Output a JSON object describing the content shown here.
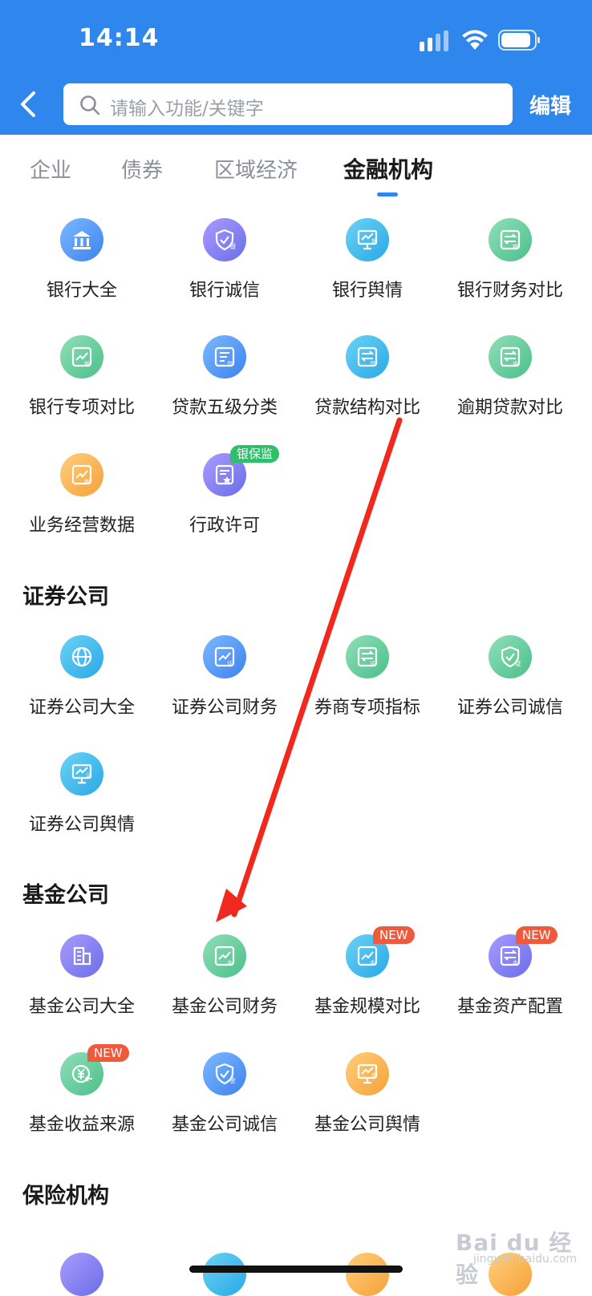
{
  "status_bar": {
    "time": "14:14"
  },
  "header": {
    "search_placeholder": "请输入功能/关键字",
    "edit_label": "编辑"
  },
  "tabs": [
    {
      "label": "企业",
      "active": false
    },
    {
      "label": "债券",
      "active": false
    },
    {
      "label": "区域经济",
      "active": false
    },
    {
      "label": "金融机构",
      "active": true
    }
  ],
  "banks": {
    "items": [
      {
        "label": "银行大全",
        "icon": "bank-icon"
      },
      {
        "label": "银行诚信",
        "icon": "shield-icon"
      },
      {
        "label": "银行舆情",
        "icon": "opinion-icon"
      },
      {
        "label": "银行财务对比",
        "icon": "compare-icon"
      },
      {
        "label": "银行专项对比",
        "icon": "chart-icon"
      },
      {
        "label": "贷款五级分类",
        "icon": "list-icon"
      },
      {
        "label": "贷款结构对比",
        "icon": "compare-icon"
      },
      {
        "label": "逾期贷款对比",
        "icon": "compare-icon"
      },
      {
        "label": "业务经营数据",
        "icon": "chart-icon"
      },
      {
        "label": "行政许可",
        "icon": "certificate-icon",
        "badge": "银保监"
      }
    ]
  },
  "securities": {
    "title": "证券公司",
    "items": [
      {
        "label": "证券公司大全",
        "icon": "globe-icon"
      },
      {
        "label": "证券公司财务",
        "icon": "chart-icon"
      },
      {
        "label": "券商专项指标",
        "icon": "compare-icon"
      },
      {
        "label": "证券公司诚信",
        "icon": "shield-icon"
      },
      {
        "label": "证券公司舆情",
        "icon": "opinion-icon"
      }
    ]
  },
  "funds": {
    "title": "基金公司",
    "items": [
      {
        "label": "基金公司大全",
        "icon": "building-icon"
      },
      {
        "label": "基金公司财务",
        "icon": "chart-icon"
      },
      {
        "label": "基金规模对比",
        "icon": "chart-icon",
        "badge": "NEW"
      },
      {
        "label": "基金资产配置",
        "icon": "compare-icon",
        "badge": "NEW"
      },
      {
        "label": "基金收益来源",
        "icon": "yuan-icon",
        "badge": "NEW"
      },
      {
        "label": "基金公司诚信",
        "icon": "shield-icon"
      },
      {
        "label": "基金公司舆情",
        "icon": "opinion-icon"
      }
    ]
  },
  "insurance": {
    "title": "保险机构"
  },
  "icon_markers": {
    "bank": "银",
    "security": "证",
    "fund": "金",
    "loan": "贷",
    "overdue": "逾"
  },
  "watermark": {
    "text": "Bai du 经验",
    "sub": "jingyan.baidu.com"
  },
  "colors": {
    "primary": "#2f86ec",
    "annotation_arrow": "#f0281e",
    "badge_new": "#f05a3c",
    "badge_green": "#2fbf6a"
  }
}
